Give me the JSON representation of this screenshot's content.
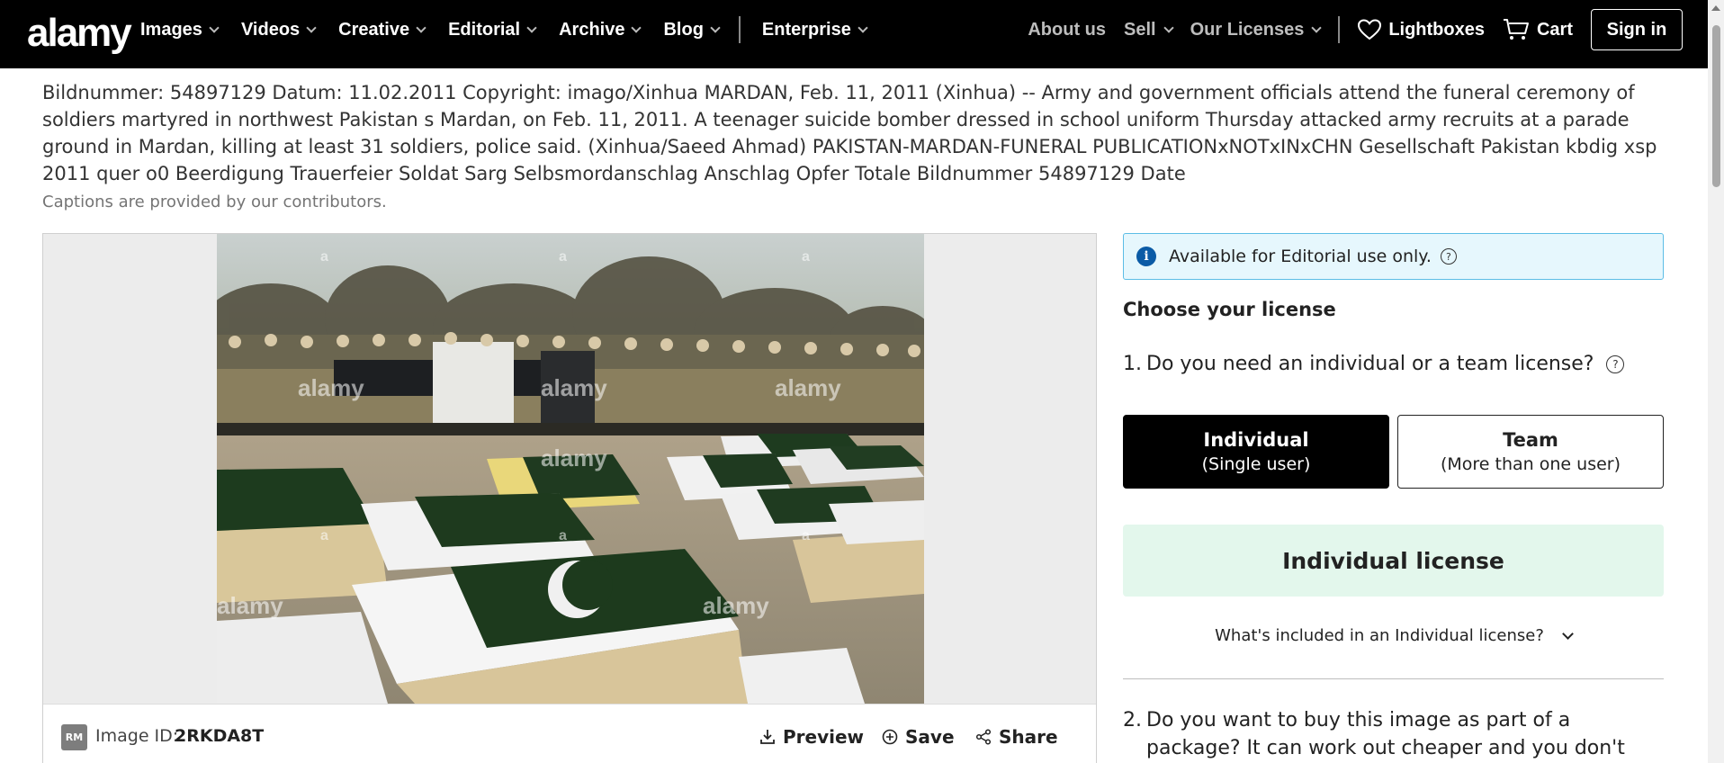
{
  "nav": {
    "logo": "alamy",
    "left_items": [
      "Images",
      "Videos",
      "Creative",
      "Editorial",
      "Archive",
      "Blog"
    ],
    "enterprise": "Enterprise",
    "about": "About us",
    "sell": "Sell",
    "licenses": "Our Licenses",
    "lightboxes": "Lightboxes",
    "cart": "Cart",
    "signin": "Sign in"
  },
  "caption": {
    "text": "Bildnummer: 54897129 Datum: 11.02.2011 Copyright: imago/Xinhua MARDAN, Feb. 11, 2011 (Xinhua) -- Army and government officials attend the funeral ceremony of soldiers martyred in northwest Pakistan s Mardan, on Feb. 11, 2011. A teenager suicide bomber dressed in school uniform Thursday attacked army recruits at a parade ground in Mardan, killing at least 31 soldiers, police said. (Xinhua/Saeed Ahmad) PAKISTAN-MARDAN-FUNERAL PUBLICATIONxNOTxINxCHN Gesellschaft Pakistan kbdig xsp 2011 quer o0 Beerdigung Trauerfeier Soldat Sarg Selbsmordanschlag Anschlag Opfer Totale Bildnummer 54897129 Date",
    "note": "Captions are provided by our contributors."
  },
  "image": {
    "badge": "RM",
    "id_label": "Image ID:",
    "id_value": "2RKDA8T",
    "watermark": "alamy",
    "watermark_letter": "a",
    "actions": {
      "preview": "Preview",
      "save": "Save",
      "share": "Share"
    }
  },
  "license": {
    "notice": "Available for Editorial use only.",
    "help": "?",
    "choose_title": "Choose your license",
    "q1_num": "1.",
    "q1_text": "Do you need an individual or a team license?",
    "individual_title": "Individual",
    "individual_sub": "(Single user)",
    "team_title": "Team",
    "team_sub": "(More than one user)",
    "banner": "Individual license",
    "included": "What's included in an Individual license?",
    "q2_num": "2.",
    "q2_text": "Do you want to buy this image as part of a package? It can work out cheaper and you don't have to choose all the"
  },
  "colors": {
    "nav_bg": "#000000",
    "notice_bg": "#e6f7fd",
    "notice_border": "#5cbde6",
    "info_icon": "#0b5ba6",
    "banner_bg": "#e3f7ec"
  }
}
